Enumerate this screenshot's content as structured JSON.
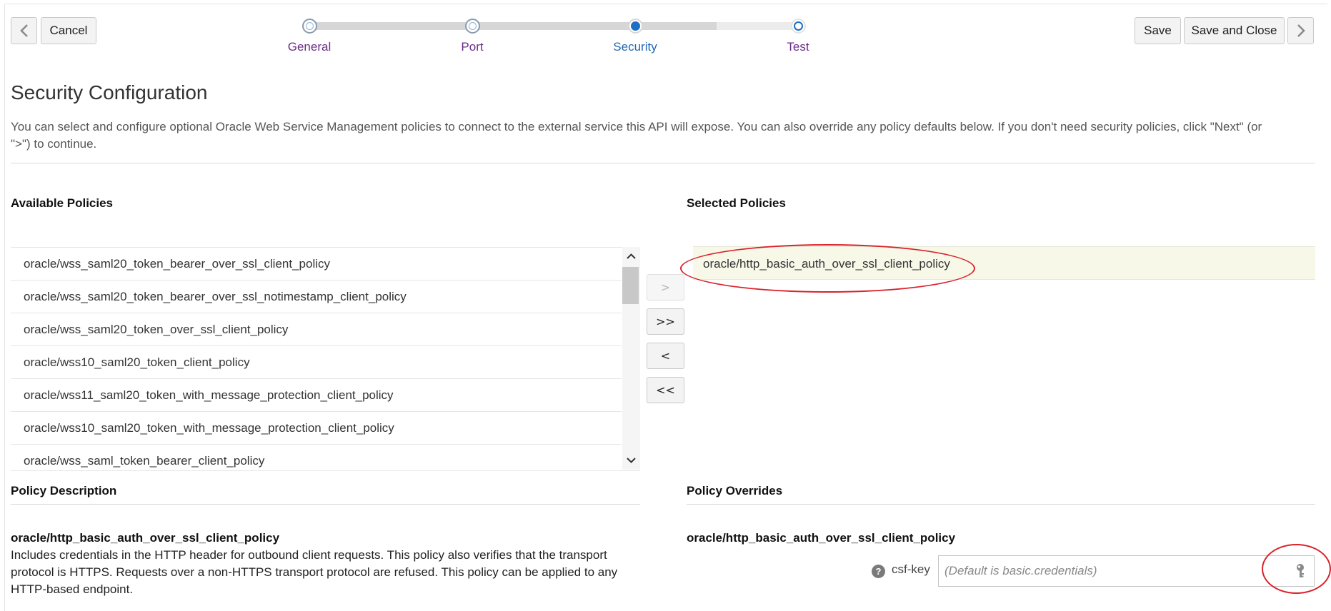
{
  "toolbar": {
    "back_icon": "chevron-left-icon",
    "cancel_label": "Cancel",
    "save_label": "Save",
    "save_close_label": "Save and Close",
    "next_icon": "chevron-right-icon"
  },
  "train": {
    "steps": [
      {
        "label": "General",
        "state": "visited"
      },
      {
        "label": "Port",
        "state": "visited"
      },
      {
        "label": "Security",
        "state": "current"
      },
      {
        "label": "Test",
        "state": "unvisited"
      }
    ]
  },
  "page": {
    "title": "Security Configuration",
    "intro": "You can select and configure optional Oracle Web Service Management policies to connect to the external service this API will expose. You can also override any policy defaults below. If you don't need security policies, click \"Next\" (or \">\") to continue."
  },
  "available": {
    "title": "Available Policies",
    "items": [
      "oracle/wss_saml20_token_bearer_over_ssl_client_policy",
      "oracle/wss_saml20_token_bearer_over_ssl_notimestamp_client_policy",
      "oracle/wss_saml20_token_over_ssl_client_policy",
      "oracle/wss10_saml20_token_client_policy",
      "oracle/wss11_saml20_token_with_message_protection_client_policy",
      "oracle/wss10_saml20_token_with_message_protection_client_policy",
      "oracle/wss_saml_token_bearer_client_policy"
    ]
  },
  "shuttle": {
    "move": ">",
    "move_all": ">>",
    "remove": "<",
    "remove_all": "<<"
  },
  "selected": {
    "title": "Selected Policies",
    "items": [
      "oracle/http_basic_auth_over_ssl_client_policy"
    ]
  },
  "description": {
    "title": "Policy Description",
    "policy_name": "oracle/http_basic_auth_over_ssl_client_policy",
    "text": "Includes credentials in the HTTP header for outbound client requests. This policy also verifies that the transport protocol is HTTPS. Requests over a non-HTTPS transport protocol are refused. This policy can be applied to any HTTP-based endpoint."
  },
  "overrides": {
    "title": "Policy Overrides",
    "policy_name": "oracle/http_basic_auth_over_ssl_client_policy",
    "help_icon": "help-icon",
    "csf_key_label": "csf-key",
    "csf_key_placeholder": "(Default is basic.credentials)",
    "csf_key_value": "",
    "key_icon": "key-icon"
  },
  "colors": {
    "annotation": "#d9222a",
    "train_current": "#1f6fc5",
    "train_visited_label": "#6b2d86",
    "selected_row_bg": "#f7f8e8"
  }
}
